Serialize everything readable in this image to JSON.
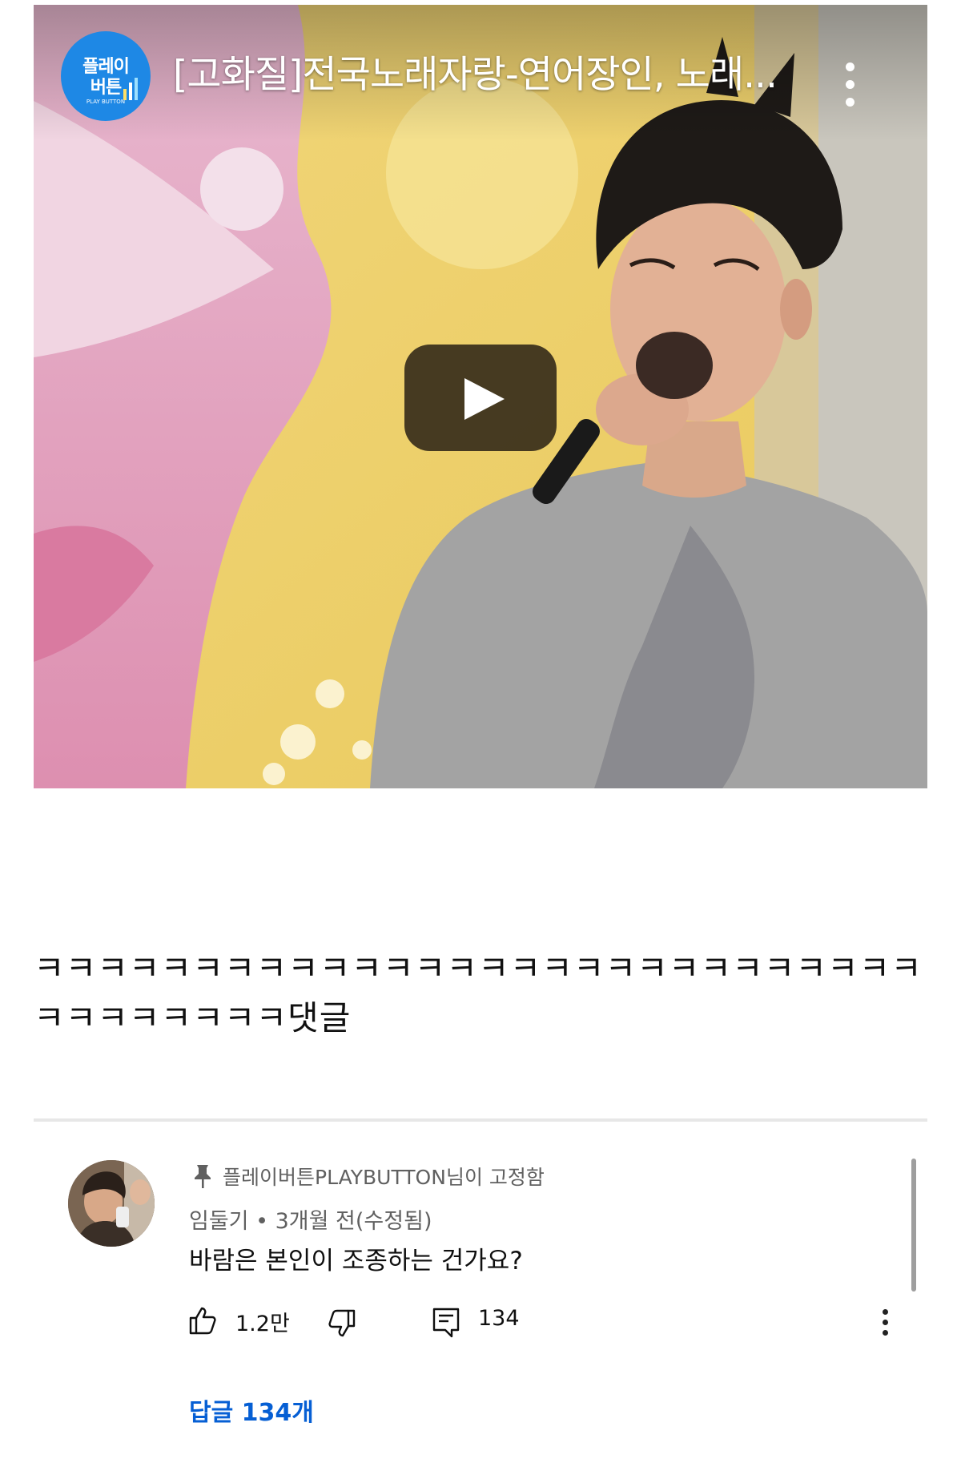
{
  "video": {
    "channel_logo_line1": "플레이",
    "channel_logo_line2": "버튼",
    "channel_logo_line3": "PLAY BUTTON",
    "title": "[고화질]전국노래자랑-연어장인, 노래..."
  },
  "caption": {
    "text": "ㅋㅋㅋㅋㅋㅋㅋㅋㅋㅋㅋㅋㅋㅋㅋㅋㅋㅋㅋㅋㅋㅋㅋㅋㅋㅋㅋㅋㅋㅋㅋㅋㅋㅋㅋㅋ댓글"
  },
  "comment": {
    "pinned_by": "플레이버튼PLAYBUTTON님이 고정함",
    "author_meta": "임둘기 • 3개월 전(수정됨)",
    "text": "바람은 본인이 조종하는 건가요?",
    "like_count": "1.2만",
    "reply_count": "134",
    "replies_link": "답글 134개"
  },
  "colors": {
    "link_blue": "#065fd4",
    "secondary_text": "#606060",
    "channel_blue": "#1e88e5"
  },
  "icons": [
    "play-icon",
    "more-vert-icon",
    "pin-icon",
    "thumbs-up-icon",
    "thumbs-down-icon",
    "reply-icon"
  ]
}
